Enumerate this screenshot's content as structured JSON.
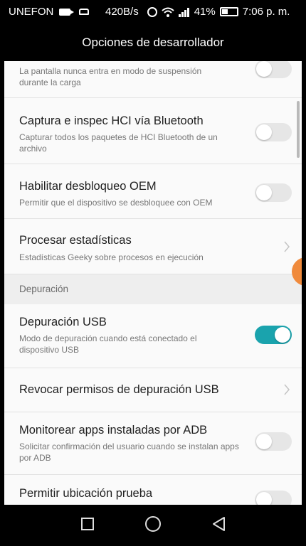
{
  "status_bar": {
    "carrier": "UNEFON",
    "speed": "420B/s",
    "battery_percent": "41%",
    "battery_level": 0.41,
    "time": "7:06 p. m.",
    "icons": [
      "video-camera-icon",
      "car-icon",
      "alarm-icon",
      "wifi-icon",
      "signal-icon",
      "battery-icon"
    ]
  },
  "app_bar": {
    "title": "Opciones de desarrollador"
  },
  "settings": {
    "stay_awake": {
      "subtitle": "La pantalla nunca entra en modo de suspensión durante la carga",
      "enabled": false
    },
    "hci_snoop": {
      "title": "Captura e inspec HCI vía Bluetooth",
      "subtitle": "Capturar todos los paquetes de HCI Bluetooth de un archivo",
      "enabled": false
    },
    "oem_unlock": {
      "title": "Habilitar desbloqueo OEM",
      "subtitle": "Permitir que el dispositivo se desbloquee con OEM",
      "enabled": false
    },
    "process_stats": {
      "title": "Procesar estadísticas",
      "subtitle": "Estadísticas Geeky sobre procesos en ejecución"
    },
    "debug_section": {
      "label": "Depuración"
    },
    "usb_debugging": {
      "title": "Depuración USB",
      "subtitle": "Modo de depuración cuando está conectado el dispositivo USB",
      "enabled": true
    },
    "revoke_usb": {
      "title": "Revocar permisos de depuración USB"
    },
    "verify_adb_apps": {
      "title": "Monitorear apps instaladas por ADB",
      "subtitle": "Solicitar confirmación del usuario cuando se instalan apps por ADB",
      "enabled": false
    },
    "mock_location": {
      "title": "Permitir ubicación prueba",
      "enabled": false
    }
  },
  "colors": {
    "accent": "#1aa3ad",
    "background": "#fafafa",
    "section_bg": "#eeeeee"
  },
  "nav_bar": {
    "icons": [
      "recents-icon",
      "home-icon",
      "back-icon"
    ]
  }
}
